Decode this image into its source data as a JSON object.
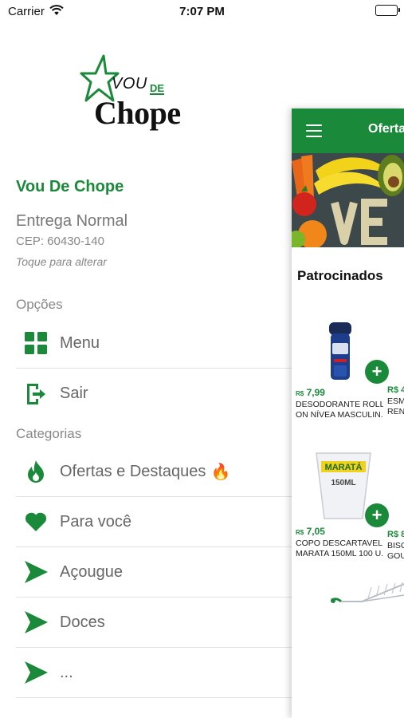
{
  "status_bar": {
    "carrier": "Carrier",
    "time": "7:07 PM"
  },
  "drawer": {
    "logo": {
      "line1": "VOU",
      "line1b": "DE",
      "line2": "Chope"
    },
    "store_name": "Vou De Chope",
    "delivery_mode": "Entrega Normal",
    "cep": "CEP: 60430-140",
    "tap_hint": "Toque para alterar",
    "options_title": "Opções",
    "options": [
      {
        "label": "Menu",
        "icon": "grid-icon"
      },
      {
        "label": "Sair",
        "icon": "logout-icon"
      }
    ],
    "categories_title": "Categorias",
    "categories": [
      {
        "label": "Ofertas e Destaques",
        "icon": "flame-icon",
        "emoji": "🔥"
      },
      {
        "label": "Para você",
        "icon": "heart-icon"
      },
      {
        "label": "Açougue",
        "icon": "arrow-right-icon"
      },
      {
        "label": "Doces",
        "icon": "arrow-right-icon"
      },
      {
        "label": "...",
        "icon": "arrow-right-icon"
      }
    ]
  },
  "main": {
    "header_title": "Ofertas",
    "sponsored_title": "Patrocinados",
    "products": [
      {
        "currency": "R$",
        "price": "7,99",
        "name_line1": "DESODORANTE ROLL",
        "name_line2": "ON NÍVEA MASCULIN...",
        "image_text": "NIVEA MEN"
      },
      {
        "currency": "R$",
        "price": "7,05",
        "name_line1": "COPO DESCARTAVEL",
        "name_line2": "MARATA 150ML 100 U...",
        "image_text": "MARATÁ",
        "image_subtext": "150ML"
      }
    ],
    "peek_products": [
      {
        "price": "R$ 4",
        "name_line1": "ESM",
        "name_line2": "REN"
      },
      {
        "price": "R$ 8",
        "name_line1": "BISC",
        "name_line2": "GOU"
      }
    ]
  },
  "colors": {
    "brand_green": "#1a8a3a",
    "muted_text": "#777777",
    "divider": "#e3e3e3"
  }
}
